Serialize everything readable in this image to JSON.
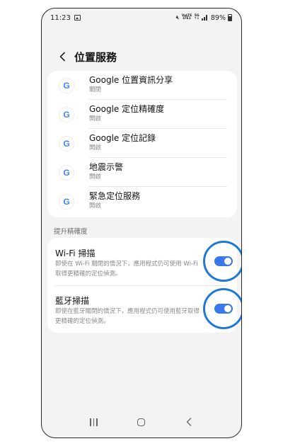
{
  "status_bar": {
    "time": "11:23",
    "volte_top": "VoLTE",
    "volte_bottom": "LTE1",
    "net_top": "5G",
    "net_bottom": "↑↓",
    "battery": "89%"
  },
  "header": {
    "title": "位置服務"
  },
  "apps": [
    {
      "title": "Google 位置資訊分享",
      "status": "關閉"
    },
    {
      "title": "Google 定位精確度",
      "status": "開啟"
    },
    {
      "title": "Google 定位記錄",
      "status": "開啟"
    },
    {
      "title": "地震示警",
      "status": "開啟"
    },
    {
      "title": "緊急定位服務",
      "status": "開啟"
    }
  ],
  "app_icon_letter": "G",
  "section": {
    "label": "提升精確度"
  },
  "toggles": [
    {
      "title": "Wi-Fi 掃描",
      "description": "即使在 Wi-Fi 關閉的情況下，應用程式仍可使用 Wi-Fi 取得更精確的定位偵測。",
      "on": true
    },
    {
      "title": "藍牙掃描",
      "description": "即使在藍牙關閉的情況下，應用程式仍可使用藍牙取得更精確的定位偵測。",
      "on": true
    }
  ],
  "colors": {
    "accent": "#3a77e8",
    "highlight": "#1e78d6",
    "background": "#f3f3f3"
  }
}
